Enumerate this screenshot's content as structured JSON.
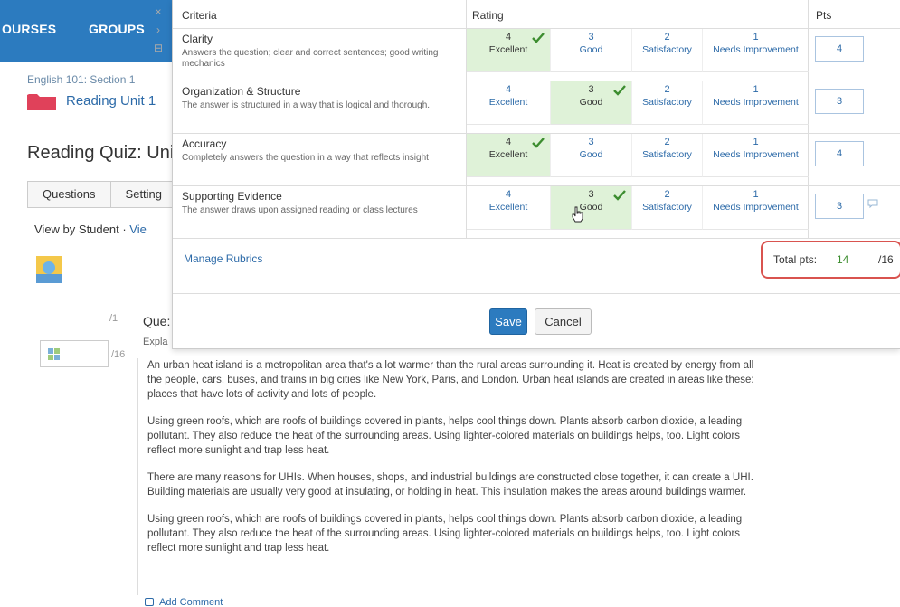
{
  "nav": {
    "items": [
      "OURSES",
      "GROUPS"
    ]
  },
  "breadcrumb": {
    "course": "English 101: Section 1",
    "unit": "Reading Unit 1"
  },
  "quiz": {
    "title": "Reading Quiz: Uni"
  },
  "tabs": [
    "Questions",
    "Setting"
  ],
  "view": {
    "by_student": "View by Student ·",
    "link": "Vie"
  },
  "side_controls": {
    "close": "×",
    "next": "›",
    "collapse": "⊟"
  },
  "question": {
    "score": "/1",
    "title": "Que:",
    "explanation": "Expla",
    "grade_total": "/16"
  },
  "answer": {
    "paragraphs": [
      "An urban heat island is a metropolitan area that's a lot warmer than the rural areas surrounding it. Heat is created by energy from all the people, cars, buses, and trains in big cities like New York, Paris, and London. Urban heat islands are created in areas like these: places that have lots of activity and lots of people.",
      "Using green roofs, which are roofs of buildings covered in plants, helps cool things down. Plants absorb carbon dioxide, a leading pollutant. They also reduce the heat of the surrounding areas. Using lighter-colored materials on buildings helps, too. Light colors reflect more sunlight and trap less heat.",
      "There are many reasons for UHIs. When houses, shops, and industrial buildings are constructed close together, it can create a UHI. Building materials are usually very good at insulating, or holding in heat. This insulation makes the areas around buildings warmer.",
      "Using green roofs, which are roofs of buildings covered in plants, helps cool things down. Plants absorb carbon dioxide, a leading pollutant. They also reduce the heat of the surrounding areas. Using lighter-colored materials on buildings helps, too. Light colors reflect more sunlight and trap less heat."
    ],
    "add_comment": "Add Comment"
  },
  "rubric": {
    "headers": {
      "criteria": "Criteria",
      "rating": "Rating",
      "pts": "Pts"
    },
    "levels": [
      {
        "num": "4",
        "label": "Excellent"
      },
      {
        "num": "3",
        "label": "Good"
      },
      {
        "num": "2",
        "label": "Satisfactory"
      },
      {
        "num": "1",
        "label": "Needs Improvement"
      }
    ],
    "rows": [
      {
        "name": "Clarity",
        "desc": "Answers the question; clear and correct sentences; good writing mechanics",
        "selected": 0,
        "pts": "4"
      },
      {
        "name": "Organization & Structure",
        "desc": "The answer is structured in a way that is logical and thorough.",
        "selected": 1,
        "pts": "3"
      },
      {
        "name": "Accuracy",
        "desc": "Completely answers the question in a way that reflects insight",
        "selected": 0,
        "pts": "4"
      },
      {
        "name": "Supporting Evidence",
        "desc": "The answer draws upon assigned reading or class lectures",
        "selected": 1,
        "pts": "3"
      }
    ],
    "manage_link": "Manage Rubrics",
    "total_label": "Total pts:",
    "total_value": "14",
    "total_max": "/16",
    "save": "Save",
    "cancel": "Cancel"
  },
  "colors": {
    "nav_blue": "#2c7bbf",
    "selected_green": "#dff2d8",
    "check_green": "#3c8d2f",
    "highlight_red": "#d9534f"
  }
}
